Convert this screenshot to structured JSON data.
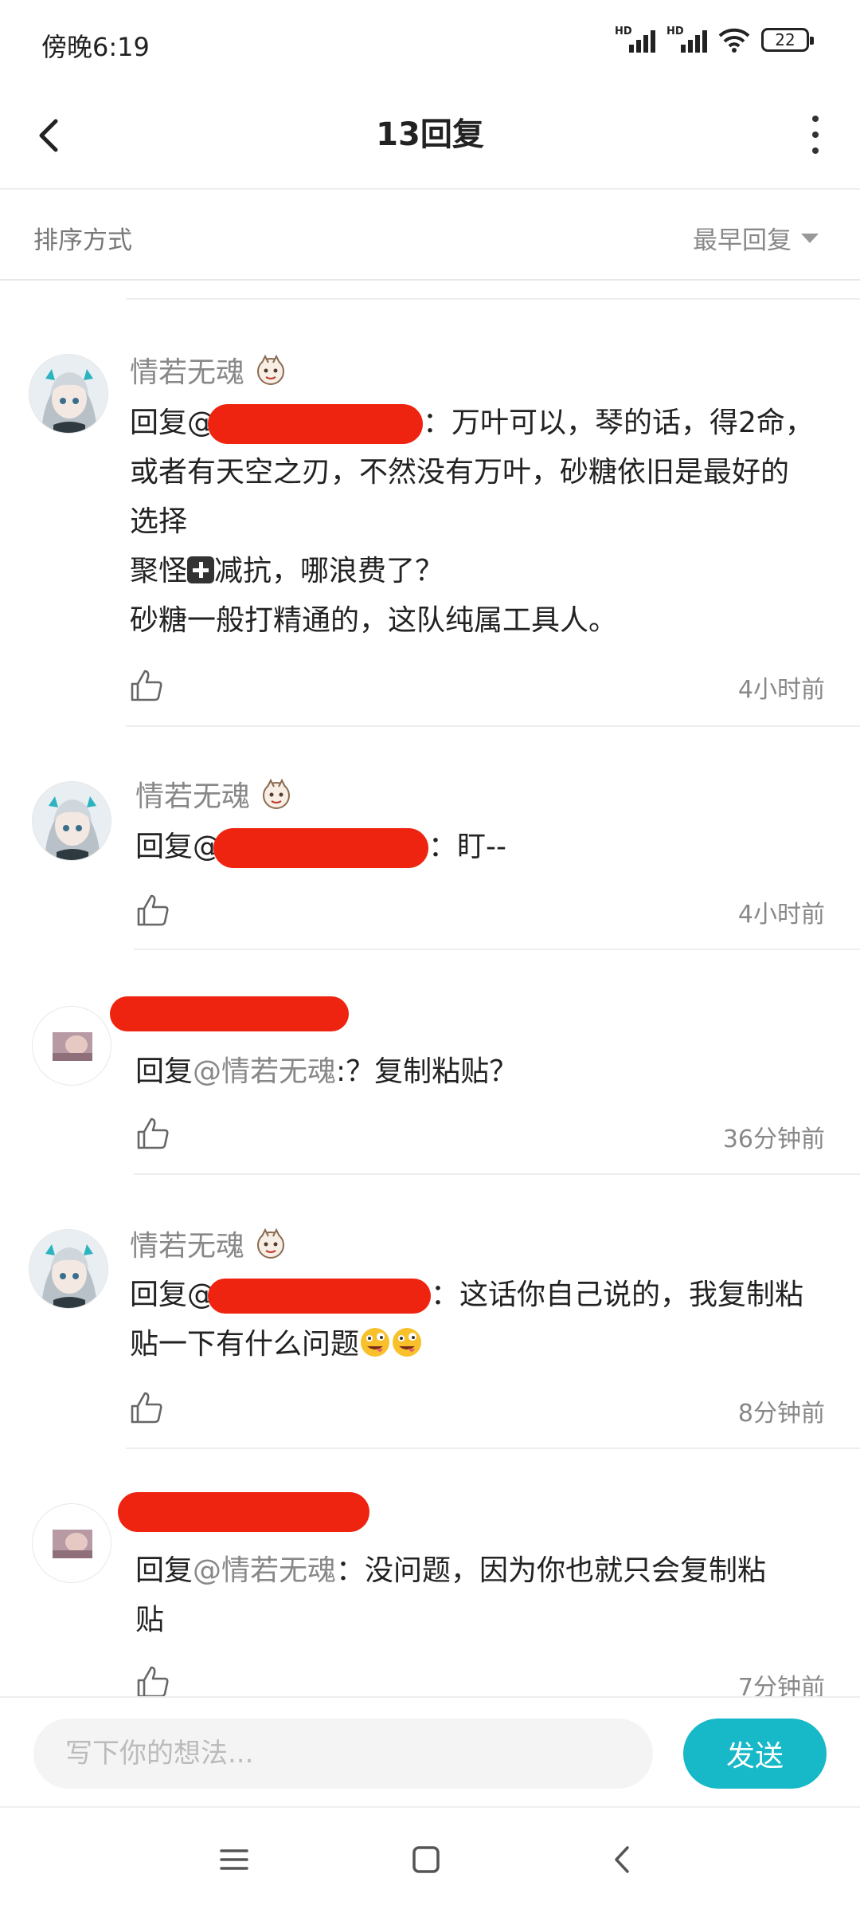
{
  "status_bar": {
    "time": "傍晚6:19",
    "battery": "22",
    "signal_label": "HD"
  },
  "header": {
    "title": "13回复"
  },
  "sort": {
    "label": "排序方式",
    "value": "最早回复"
  },
  "comments": [
    {
      "username": "情若无魂",
      "reply_prefix": "回复@",
      "after_redaction": "：万叶可以，琴的话，得2命，\n或者有天空之刃，不然没有万叶，砂糖依旧是最好的\n选择\n聚怪",
      "line_after_plus": "减抗，哪浪费了？\n砂糖一般打精通的，这队纯属工具人。",
      "time": "4小时前"
    },
    {
      "username": "情若无魂",
      "reply_prefix": "回复@",
      "after_redaction": "：盯--",
      "time": "4小时前"
    },
    {
      "reply_prefix": "回复",
      "mention": "@情若无魂",
      "text": ":？复制粘贴？",
      "time": "36分钟前"
    },
    {
      "username": "情若无魂",
      "reply_prefix": "回复@",
      "after_redaction": "：这话你自己说的，我复制粘\n贴一下有什么问题",
      "time": "8分钟前"
    },
    {
      "reply_prefix": "回复",
      "mention": "@情若无魂",
      "text": "：没问题，因为你也就只会复制粘\n贴",
      "time": "7分钟前"
    }
  ],
  "input": {
    "placeholder": "写下你的想法...",
    "send_label": "发送"
  },
  "colors": {
    "accent": "#17b8c8",
    "redaction": "#ee2410",
    "muted": "#888888"
  }
}
